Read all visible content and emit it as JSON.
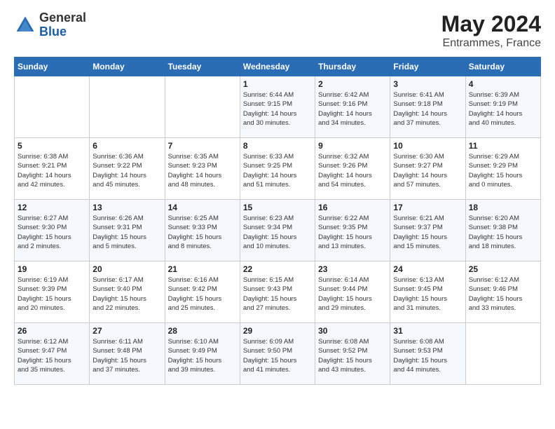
{
  "header": {
    "logo_general": "General",
    "logo_blue": "Blue",
    "title": "May 2024",
    "subtitle": "Entrammes, France"
  },
  "days_of_week": [
    "Sunday",
    "Monday",
    "Tuesday",
    "Wednesday",
    "Thursday",
    "Friday",
    "Saturday"
  ],
  "weeks": [
    [
      {
        "day": "",
        "info": ""
      },
      {
        "day": "",
        "info": ""
      },
      {
        "day": "",
        "info": ""
      },
      {
        "day": "1",
        "info": "Sunrise: 6:44 AM\nSunset: 9:15 PM\nDaylight: 14 hours\nand 30 minutes."
      },
      {
        "day": "2",
        "info": "Sunrise: 6:42 AM\nSunset: 9:16 PM\nDaylight: 14 hours\nand 34 minutes."
      },
      {
        "day": "3",
        "info": "Sunrise: 6:41 AM\nSunset: 9:18 PM\nDaylight: 14 hours\nand 37 minutes."
      },
      {
        "day": "4",
        "info": "Sunrise: 6:39 AM\nSunset: 9:19 PM\nDaylight: 14 hours\nand 40 minutes."
      }
    ],
    [
      {
        "day": "5",
        "info": "Sunrise: 6:38 AM\nSunset: 9:21 PM\nDaylight: 14 hours\nand 42 minutes."
      },
      {
        "day": "6",
        "info": "Sunrise: 6:36 AM\nSunset: 9:22 PM\nDaylight: 14 hours\nand 45 minutes."
      },
      {
        "day": "7",
        "info": "Sunrise: 6:35 AM\nSunset: 9:23 PM\nDaylight: 14 hours\nand 48 minutes."
      },
      {
        "day": "8",
        "info": "Sunrise: 6:33 AM\nSunset: 9:25 PM\nDaylight: 14 hours\nand 51 minutes."
      },
      {
        "day": "9",
        "info": "Sunrise: 6:32 AM\nSunset: 9:26 PM\nDaylight: 14 hours\nand 54 minutes."
      },
      {
        "day": "10",
        "info": "Sunrise: 6:30 AM\nSunset: 9:27 PM\nDaylight: 14 hours\nand 57 minutes."
      },
      {
        "day": "11",
        "info": "Sunrise: 6:29 AM\nSunset: 9:29 PM\nDaylight: 15 hours\nand 0 minutes."
      }
    ],
    [
      {
        "day": "12",
        "info": "Sunrise: 6:27 AM\nSunset: 9:30 PM\nDaylight: 15 hours\nand 2 minutes."
      },
      {
        "day": "13",
        "info": "Sunrise: 6:26 AM\nSunset: 9:31 PM\nDaylight: 15 hours\nand 5 minutes."
      },
      {
        "day": "14",
        "info": "Sunrise: 6:25 AM\nSunset: 9:33 PM\nDaylight: 15 hours\nand 8 minutes."
      },
      {
        "day": "15",
        "info": "Sunrise: 6:23 AM\nSunset: 9:34 PM\nDaylight: 15 hours\nand 10 minutes."
      },
      {
        "day": "16",
        "info": "Sunrise: 6:22 AM\nSunset: 9:35 PM\nDaylight: 15 hours\nand 13 minutes."
      },
      {
        "day": "17",
        "info": "Sunrise: 6:21 AM\nSunset: 9:37 PM\nDaylight: 15 hours\nand 15 minutes."
      },
      {
        "day": "18",
        "info": "Sunrise: 6:20 AM\nSunset: 9:38 PM\nDaylight: 15 hours\nand 18 minutes."
      }
    ],
    [
      {
        "day": "19",
        "info": "Sunrise: 6:19 AM\nSunset: 9:39 PM\nDaylight: 15 hours\nand 20 minutes."
      },
      {
        "day": "20",
        "info": "Sunrise: 6:17 AM\nSunset: 9:40 PM\nDaylight: 15 hours\nand 22 minutes."
      },
      {
        "day": "21",
        "info": "Sunrise: 6:16 AM\nSunset: 9:42 PM\nDaylight: 15 hours\nand 25 minutes."
      },
      {
        "day": "22",
        "info": "Sunrise: 6:15 AM\nSunset: 9:43 PM\nDaylight: 15 hours\nand 27 minutes."
      },
      {
        "day": "23",
        "info": "Sunrise: 6:14 AM\nSunset: 9:44 PM\nDaylight: 15 hours\nand 29 minutes."
      },
      {
        "day": "24",
        "info": "Sunrise: 6:13 AM\nSunset: 9:45 PM\nDaylight: 15 hours\nand 31 minutes."
      },
      {
        "day": "25",
        "info": "Sunrise: 6:12 AM\nSunset: 9:46 PM\nDaylight: 15 hours\nand 33 minutes."
      }
    ],
    [
      {
        "day": "26",
        "info": "Sunrise: 6:12 AM\nSunset: 9:47 PM\nDaylight: 15 hours\nand 35 minutes."
      },
      {
        "day": "27",
        "info": "Sunrise: 6:11 AM\nSunset: 9:48 PM\nDaylight: 15 hours\nand 37 minutes."
      },
      {
        "day": "28",
        "info": "Sunrise: 6:10 AM\nSunset: 9:49 PM\nDaylight: 15 hours\nand 39 minutes."
      },
      {
        "day": "29",
        "info": "Sunrise: 6:09 AM\nSunset: 9:50 PM\nDaylight: 15 hours\nand 41 minutes."
      },
      {
        "day": "30",
        "info": "Sunrise: 6:08 AM\nSunset: 9:52 PM\nDaylight: 15 hours\nand 43 minutes."
      },
      {
        "day": "31",
        "info": "Sunrise: 6:08 AM\nSunset: 9:53 PM\nDaylight: 15 hours\nand 44 minutes."
      },
      {
        "day": "",
        "info": ""
      }
    ]
  ]
}
